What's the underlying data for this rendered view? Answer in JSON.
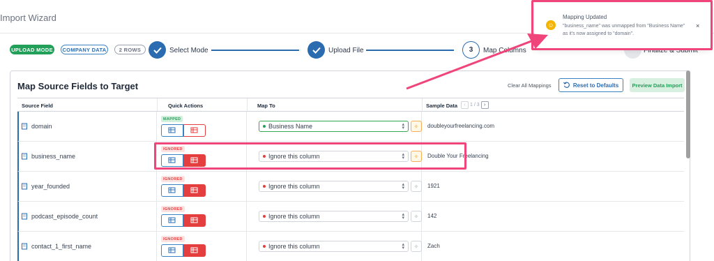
{
  "header": {
    "title": "Import Wizard"
  },
  "badges": {
    "mode": "UPLOAD MODE",
    "entity": "COMPANY DATA",
    "rows": "2 ROWS"
  },
  "steps": [
    {
      "label": "Select Mode",
      "state": "done"
    },
    {
      "label": "Upload File",
      "state": "done"
    },
    {
      "label": "Map Columns",
      "number": "3",
      "state": "current"
    },
    {
      "label": "Finalize & Submit",
      "state": "pending"
    }
  ],
  "card": {
    "title": "Map Source Fields to Target",
    "clear_all": "Clear All Mappings",
    "reset": "Reset to Defaults",
    "preview": "Preview Data Import"
  },
  "table": {
    "headers": {
      "source": "Source Field",
      "quick": "Quick Actions",
      "map": "Map To",
      "sample": "Sample Data"
    },
    "pager": "1 / 3",
    "rows": [
      {
        "field": "domain",
        "status": "MAPPED",
        "map_to": "Business Name",
        "sample": "doubleyourfreelancing.com"
      },
      {
        "field": "business_name",
        "status": "IGNORED",
        "map_to": "Ignore this column",
        "sample": "Double Your Freelancing"
      },
      {
        "field": "year_founded",
        "status": "IGNORED",
        "map_to": "Ignore this column",
        "sample": "1921"
      },
      {
        "field": "podcast_episode_count",
        "status": "IGNORED",
        "map_to": "Ignore this column",
        "sample": "142"
      },
      {
        "field": "contact_1_first_name",
        "status": "IGNORED",
        "map_to": "Ignore this column",
        "sample": "Zach"
      }
    ]
  },
  "toast": {
    "title": "Mapping Updated",
    "message": "\"business_name\" was unmapped from \"Business Name\" as it's now assigned to \"domain\".",
    "close": "×"
  },
  "colors": {
    "primary": "#2b6cb0",
    "success": "#22a05a",
    "danger": "#e53e3e",
    "annotation": "#f0457a",
    "warning": "#f5b400"
  }
}
